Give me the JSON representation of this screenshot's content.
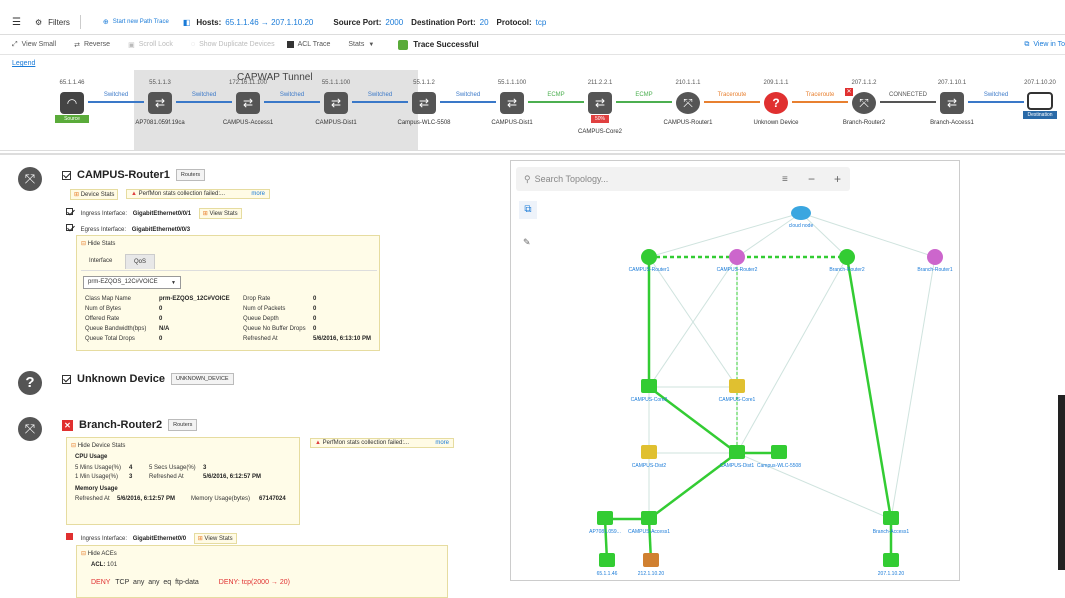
{
  "topbar": {
    "filters_label": "Filters",
    "start_new": "Start new Path Trace",
    "hosts_label": "Hosts:",
    "hosts_value": "65.1.1.46 → 207.1.10.20",
    "sport_label": "Source Port:",
    "sport_value": "2000",
    "dport_label": "Destination Port:",
    "dport_value": "20",
    "proto_label": "Protocol:",
    "proto_value": "tcp"
  },
  "toolbar": {
    "view_small": "View Small",
    "reverse": "Reverse",
    "scroll_lock": "Scroll Lock",
    "show_dup": "Show Duplicate Devices",
    "acl_trace": "ACL Trace",
    "stats": "Stats",
    "trace_status": "Trace Successful",
    "view_in": "View in To"
  },
  "legend": "Legend",
  "capwap_label": "CAPWAP Tunnel",
  "path_nodes": [
    {
      "ip": "65.1.1.46",
      "name": "",
      "badge": "Source",
      "badge_color": "#5aab3a",
      "color": "#555"
    },
    {
      "ip": "55.1.1.3",
      "name": "AP7081.059f.19ca",
      "color": "#555"
    },
    {
      "ip": "172.16.11.100",
      "name": "CAMPUS-Access1",
      "color": "#555"
    },
    {
      "ip": "55.1.1.100",
      "name": "CAMPUS-Dist1",
      "color": "#555"
    },
    {
      "ip": "55.1.1.2",
      "name": "Campus-WLC-5508",
      "color": "#555"
    },
    {
      "ip": "55.1.1.100",
      "name": "CAMPUS-Dist1",
      "color": "#555"
    },
    {
      "ip": "211.2.2.1",
      "name": "CAMPUS-Core2",
      "badge": "50%",
      "badge_color": "#e04040",
      "color": "#555"
    },
    {
      "ip": "210.1.1.1",
      "name": "CAMPUS-Router1",
      "color": "#555"
    },
    {
      "ip": "209.1.1.1",
      "name": "Unknown Device",
      "color": "#e03030"
    },
    {
      "ip": "207.1.1.2",
      "name": "Branch-Router2",
      "color": "#555"
    },
    {
      "ip": "207.1.10.1",
      "name": "Branch-Access1",
      "color": "#555"
    },
    {
      "ip": "207.1.10.20",
      "name": "",
      "badge": "Destination",
      "badge_color": "#2a6aa8",
      "color": "#555"
    }
  ],
  "path_links": [
    {
      "label": "Switched",
      "color": "#3a78c8"
    },
    {
      "label": "Switched",
      "color": "#3a78c8"
    },
    {
      "label": "Switched",
      "color": "#3a78c8"
    },
    {
      "label": "Switched",
      "color": "#3a78c8"
    },
    {
      "label": "Switched",
      "color": "#3a78c8"
    },
    {
      "label": "ECMP",
      "color": "#4caf50"
    },
    {
      "label": "ECMP",
      "color": "#4caf50"
    },
    {
      "label": "Traceroute",
      "color": "#e88030"
    },
    {
      "label": "Traceroute",
      "color": "#e88030"
    },
    {
      "label": "CONNECTED",
      "color": "#555"
    },
    {
      "label": "Switched",
      "color": "#3a78c8"
    }
  ],
  "router1": {
    "title": "CAMPUS-Router1",
    "tag": "Routers",
    "device_stats": "Device Stats",
    "perfmon": "PerfMon stats collection failed:...",
    "more": "more",
    "ingress_label": "Ingress Interface:",
    "ingress_value": "GigabitEthernet0/0/1",
    "view_stats": "View Stats",
    "egress_label": "Egress Interface:",
    "egress_value": "GigabitEthernet0/0/3",
    "hide_stats": "Hide Stats",
    "tab_interface": "Interface",
    "tab_qos": "QoS",
    "select_value": "prm-EZQOS_12C#VOICE",
    "stats": [
      [
        "Class Map Name",
        "prm-EZQOS_12C#VOICE",
        "Drop Rate",
        "0"
      ],
      [
        "Num of Bytes",
        "0",
        "Num of Packets",
        "0"
      ],
      [
        "Offered Rate",
        "0",
        "Queue Depth",
        "0"
      ],
      [
        "Queue Bandwidth(bps)",
        "N/A",
        "Queue No Buffer Drops",
        "0"
      ],
      [
        "Queue Total Drops",
        "0",
        "Refreshed At",
        "5/6/2016, 6:13:10 PM"
      ]
    ]
  },
  "unknown": {
    "title": "Unknown Device",
    "tag": "UNKNOWN_DEVICE"
  },
  "router2": {
    "title": "Branch-Router2",
    "tag": "Routers",
    "hide_device_stats": "Hide Device Stats",
    "perfmon": "PerfMon stats collection failed:...",
    "more": "more",
    "cpu_usage": "CPU Usage",
    "cpu_rows": [
      [
        "5 Mins Usage(%)",
        "4",
        "5 Secs Usage(%)",
        "3"
      ],
      [
        "1 Min Usage(%)",
        "3",
        "Refreshed At",
        "5/6/2016, 6:12:57 PM"
      ]
    ],
    "memory_usage": "Memory Usage",
    "mem_row": [
      "Refreshed At",
      "5/6/2016, 6:12:57 PM",
      "Memory Usage(bytes)",
      "67147024"
    ],
    "ingress_label": "Ingress Interface:",
    "ingress_value": "GigabitEthernet0/0",
    "view_stats": "View Stats",
    "hide_aces": "Hide ACEs",
    "acl_label": "ACL:",
    "acl_value": "101",
    "ace_deny": "DENY",
    "ace_rule": "TCP  any  any  eq  ftp-data",
    "ace_result": "DENY: tcp(2000 → 20)"
  },
  "topology": {
    "search_placeholder": "Search Topology...",
    "nodes": [
      "cloud node",
      "CAMPUS-Router1",
      "CAMPUS-Router2",
      "Branch-Router2",
      "Branch-Router1",
      "CAMPUS-Core2",
      "CAMPUS-Core1",
      "CAMPUS-Dist2",
      "CAMPUS-Dist1",
      "Campus-WLC-5508",
      "AP7081.059...",
      "CAMPUS-Access1",
      "Branch-Access1",
      "65.1.1.46",
      "212.1.10.20",
      "207.1.10.20"
    ]
  }
}
